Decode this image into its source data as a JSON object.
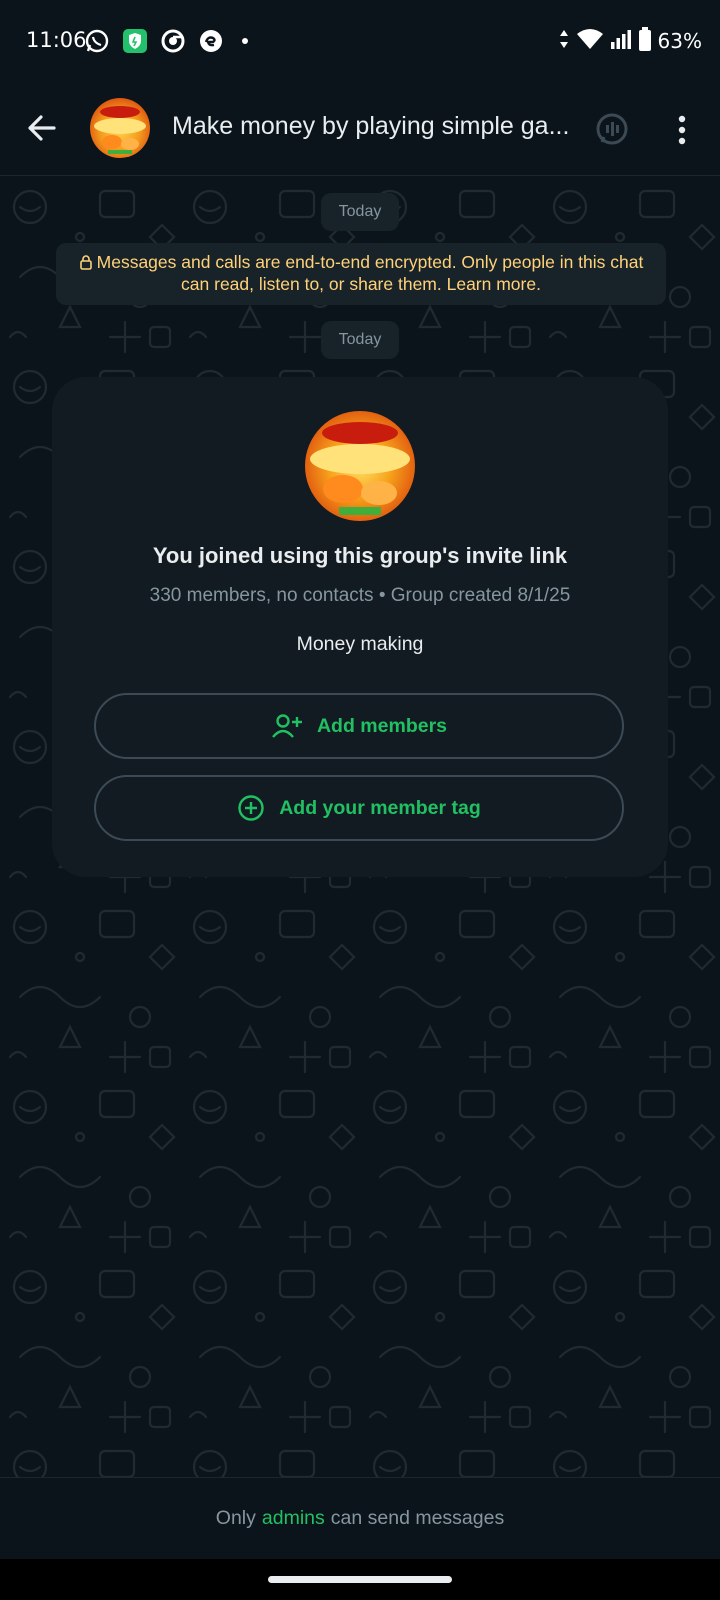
{
  "status_bar": {
    "time": "11:06",
    "battery": "63%",
    "icons": [
      "whatsapp-icon",
      "shield-app-icon",
      "chrome-icon",
      "edge-app-icon",
      "notification-dot",
      "data-arrows-icon",
      "wifi-icon",
      "signal-icon",
      "battery-icon"
    ]
  },
  "header": {
    "title": "Make money by playing simple ga...",
    "back_icon": "arrow-back-icon",
    "call_icon": "voice-chat-icon",
    "menu_icon": "more-vert-icon"
  },
  "chat": {
    "date_chip_1": "Today",
    "encryption_notice": "Messages and calls are end-to-end encrypted. Only people in this chat can read, listen to, or share them. Learn more.",
    "date_chip_2": "Today"
  },
  "group_card": {
    "title": "You joined using this group's invite link",
    "subtitle": "330 members, no contacts • Group created 8/1/25",
    "description": "Money making",
    "add_members_label": "Add members",
    "member_tag_label": "Add your member tag"
  },
  "footer": {
    "before": "Only",
    "link": "admins",
    "after": "can send messages"
  },
  "colors": {
    "background": "#0b141a",
    "accent_green": "#21c063",
    "notice_yellow": "#ffd279",
    "card": "#111b21",
    "muted_text": "#8696a0"
  }
}
